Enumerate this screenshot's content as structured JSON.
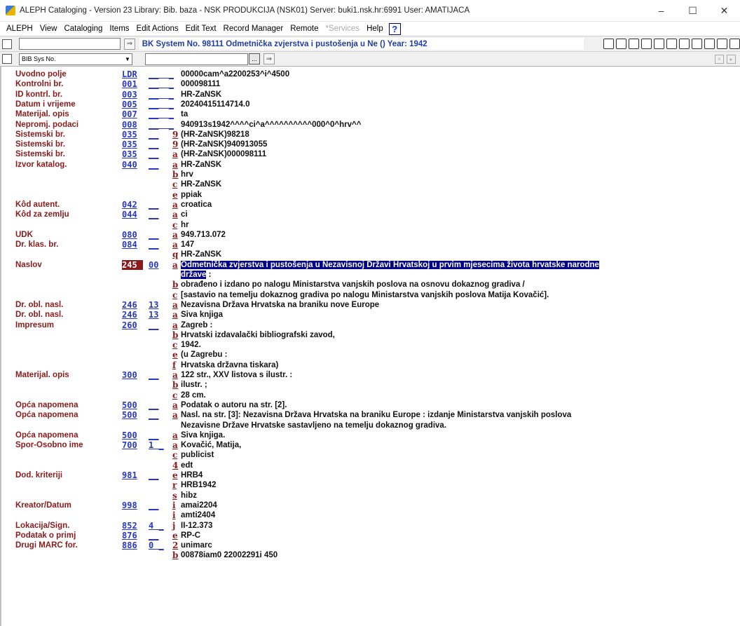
{
  "window": {
    "title": "ALEPH Cataloging - Version 23  Library:  Bib. baza - NSK PRODUKCIJA (NSK01)  Server:  buki1.nsk.hr:6991  User:  AMATIJACA",
    "minimize": "–",
    "maximize": "☐",
    "close": "✕"
  },
  "menu": [
    "ALEPH",
    "View",
    "Cataloging",
    "Items",
    "Edit Actions",
    "Edit Text",
    "Record Manager",
    "Remote",
    "*Services",
    "Help"
  ],
  "help_icon": "?",
  "toolbar": {
    "record_title": "BK System No. 98111 Odmetnička zvjerstva i pustošenja u Ne () Year: 1942",
    "search_select": "BIB Sys No.",
    "arrow": "⇒",
    "browse": "..."
  },
  "record": [
    {
      "label": "Uvodno polje",
      "tag": "LDR",
      "ind": "",
      "sub": "",
      "val": "00000cam^a2200253^i^4500"
    },
    {
      "label": "Kontrolni br.",
      "tag": "001",
      "ind": "",
      "sub": "",
      "val": "000098111"
    },
    {
      "label": "ID kontrl. br.",
      "tag": "003",
      "ind": "",
      "sub": "",
      "val": "HR-ZaNSK"
    },
    {
      "label": "Datum i vrijeme",
      "tag": "005",
      "ind": "",
      "sub": "",
      "val": "20240415114714.0"
    },
    {
      "label": "Materijal. opis",
      "tag": "007",
      "ind": "",
      "sub": "",
      "val": "ta"
    },
    {
      "label": "Nepromj. podaci",
      "tag": "008",
      "ind": "",
      "sub": "",
      "val": "940913s1942^^^^ci^a^^^^^^^^^^000^0^hrv^^"
    },
    {
      "label": "Sistemski br.",
      "tag": "035",
      "ind": "",
      "sub": "9",
      "val": "(HR-ZaNSK)98218"
    },
    {
      "label": "Sistemski br.",
      "tag": "035",
      "ind": "",
      "sub": "9",
      "val": "(HR-ZaNSK)940913055"
    },
    {
      "label": "Sistemski br.",
      "tag": "035",
      "ind": "",
      "sub": "a",
      "val": "(HR-ZaNSK)000098111"
    },
    {
      "label": "Izvor katalog.",
      "tag": "040",
      "ind": "",
      "sub": "a",
      "val": "HR-ZaNSK"
    },
    {
      "label": "",
      "tag": "",
      "ind": "",
      "sub": "b",
      "val": "hrv"
    },
    {
      "label": "",
      "tag": "",
      "ind": "",
      "sub": "c",
      "val": "HR-ZaNSK"
    },
    {
      "label": "",
      "tag": "",
      "ind": "",
      "sub": "e",
      "val": "ppiak"
    },
    {
      "label": "Kôd autent.",
      "tag": "042",
      "ind": "",
      "sub": "a",
      "val": "croatica"
    },
    {
      "label": "Kôd za zemlju",
      "tag": "044",
      "ind": "",
      "sub": "a",
      "val": "ci"
    },
    {
      "label": "",
      "tag": "",
      "ind": "",
      "sub": "c",
      "val": "hr"
    },
    {
      "label": "UDK",
      "tag": "080",
      "ind": "",
      "sub": "a",
      "val": "949.713.072"
    },
    {
      "label": "Dr. klas. br.",
      "tag": "084",
      "ind": "",
      "sub": "a",
      "val": "147"
    },
    {
      "label": "",
      "tag": "",
      "ind": "",
      "sub": "q",
      "val": "HR-ZaNSK"
    },
    {
      "label": "Naslov",
      "tag": "245",
      "ind": "00",
      "sub": "a",
      "val": "Odmetnička zvjerstva i pustošenja u Nezavisnoj Državi Hrvatskoj u prvim mjesecima života hrvatske narodne",
      "highlight": true,
      "selected": true
    },
    {
      "label": "",
      "tag": "",
      "ind": "",
      "sub": "",
      "val": "države",
      "highlight": true,
      "tail": " :"
    },
    {
      "label": "",
      "tag": "",
      "ind": "",
      "sub": "b",
      "val": "obrađeno i izdano po nalogu Ministarstva vanjskih poslova na osnovu dokaznog gradiva /"
    },
    {
      "label": "",
      "tag": "",
      "ind": "",
      "sub": "c",
      "val": "[sastavio na temelju dokaznog gradiva po nalogu Ministarstva vanjskih poslova Matija Kovačić]."
    },
    {
      "label": "Dr. obl. nasl.",
      "tag": "246",
      "ind": "13",
      "sub": "a",
      "val": "Nezavisna Država Hrvatska na braniku nove Europe"
    },
    {
      "label": "Dr. obl. nasl.",
      "tag": "246",
      "ind": "13",
      "sub": "a",
      "val": "Siva knjiga"
    },
    {
      "label": "Impresum",
      "tag": "260",
      "ind": "",
      "sub": "a",
      "val": "Zagreb :"
    },
    {
      "label": "",
      "tag": "",
      "ind": "",
      "sub": "b",
      "val": "Hrvatski izdavalački bibliografski zavod,"
    },
    {
      "label": "",
      "tag": "",
      "ind": "",
      "sub": "c",
      "val": "1942."
    },
    {
      "label": "",
      "tag": "",
      "ind": "",
      "sub": "e",
      "val": "(u Zagrebu :"
    },
    {
      "label": "",
      "tag": "",
      "ind": "",
      "sub": "f",
      "val": "Hrvatska državna tiskara)"
    },
    {
      "label": "Materijal. opis",
      "tag": "300",
      "ind": "",
      "sub": "a",
      "val": "122 str., XXV listova s ilustr. :"
    },
    {
      "label": "",
      "tag": "",
      "ind": "",
      "sub": "b",
      "val": "ilustr. ;"
    },
    {
      "label": "",
      "tag": "",
      "ind": "",
      "sub": "c",
      "val": "28 cm."
    },
    {
      "label": "Opća napomena",
      "tag": "500",
      "ind": "",
      "sub": "a",
      "val": "Podatak o autoru na str. [2]."
    },
    {
      "label": "Opća napomena",
      "tag": "500",
      "ind": "",
      "sub": "a",
      "val": "Nasl. na str. [3]: Nezavisna Država Hrvatska na braniku Europe : izdanje Ministarstva vanjskih poslova"
    },
    {
      "label": "",
      "tag": "",
      "ind": "",
      "sub": "",
      "val": "Nezavisne Države Hrvatske sastavljeno na temelju dokaznog gradiva."
    },
    {
      "label": "Opća napomena",
      "tag": "500",
      "ind": "",
      "sub": "a",
      "val": "Siva knjiga."
    },
    {
      "label": "Spor-Osobno ime",
      "tag": "700",
      "ind": "1",
      "sub": "a",
      "val": "Kovačić, Matija,"
    },
    {
      "label": "",
      "tag": "",
      "ind": "",
      "sub": "c",
      "val": "publicist"
    },
    {
      "label": "",
      "tag": "",
      "ind": "",
      "sub": "4",
      "val": "edt"
    },
    {
      "label": "Dod. kriteriji",
      "tag": "981",
      "ind": "",
      "sub": "e",
      "val": "HRB4"
    },
    {
      "label": "",
      "tag": "",
      "ind": "",
      "sub": "r",
      "val": "HRB1942"
    },
    {
      "label": "",
      "tag": "",
      "ind": "",
      "sub": "s",
      "val": "hibz"
    },
    {
      "label": "Kreator/Datum",
      "tag": "998",
      "ind": "",
      "sub": "i",
      "val": "amai2204"
    },
    {
      "label": "",
      "tag": "",
      "ind": "",
      "sub": "i",
      "val": "amti2404"
    },
    {
      "label": "Lokacija/Sign.",
      "tag": "852",
      "ind": "4",
      "sub": "j",
      "val": "II-12.373"
    },
    {
      "label": "Podatak o primj",
      "tag": "876",
      "ind": "",
      "sub": "e",
      "val": "RP-C"
    },
    {
      "label": "Drugi MARC for.",
      "tag": "886",
      "ind": "0",
      "sub": "2",
      "val": "unimarc"
    },
    {
      "label": "",
      "tag": "",
      "ind": "",
      "sub": "b",
      "val": "00878iam0 22002291i 450"
    }
  ]
}
